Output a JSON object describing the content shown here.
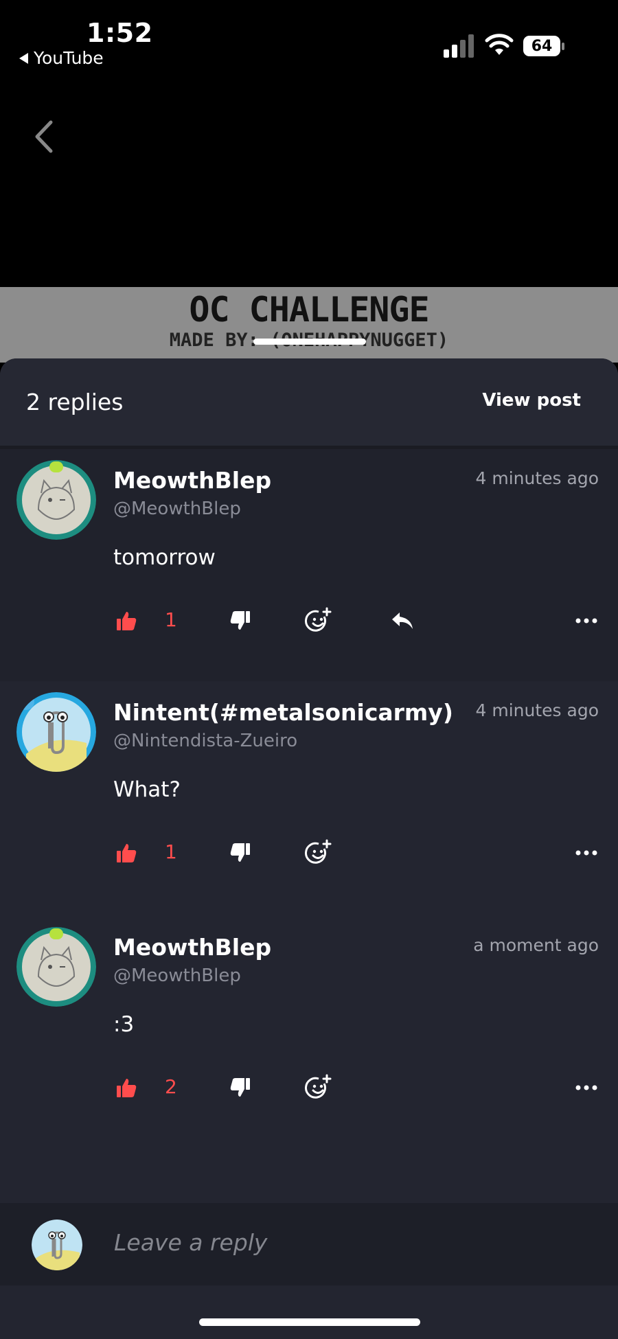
{
  "status_bar": {
    "time": "1:52",
    "back_app": "YouTube",
    "battery": "64"
  },
  "thumbnail": {
    "title": "OC CHALLENGE",
    "subtitle": "MADE BY: (ONEHAPPYNUGGET)"
  },
  "sheet": {
    "replies_count": "2 replies",
    "view_post": "View post"
  },
  "comments": [
    {
      "author": "MeowthBlep",
      "handle": "@MeowthBlep",
      "time": "4 minutes ago",
      "text": "tomorrow",
      "likes": "1",
      "has_reply": true
    },
    {
      "author": "Nintent(#metalsonicarmy)",
      "handle": "@Nintendista-Zueiro",
      "time": "4 minutes ago",
      "text": "What?",
      "likes": "1",
      "has_reply": false
    },
    {
      "author": "MeowthBlep",
      "handle": "@MeowthBlep",
      "time": "a moment ago",
      "text": ":3",
      "likes": "2",
      "has_reply": false
    }
  ],
  "composer": {
    "placeholder": "Leave a reply"
  },
  "colors": {
    "like_active": "#ff4d4d",
    "sheet_bg": "#232530",
    "header_bg": "#262833"
  },
  "icons": [
    "thumbs-up-icon",
    "thumbs-down-icon",
    "add-emoji-icon",
    "reply-icon",
    "more-options-icon",
    "back-chevron-icon",
    "signal-icon",
    "wifi-icon",
    "battery-icon"
  ]
}
